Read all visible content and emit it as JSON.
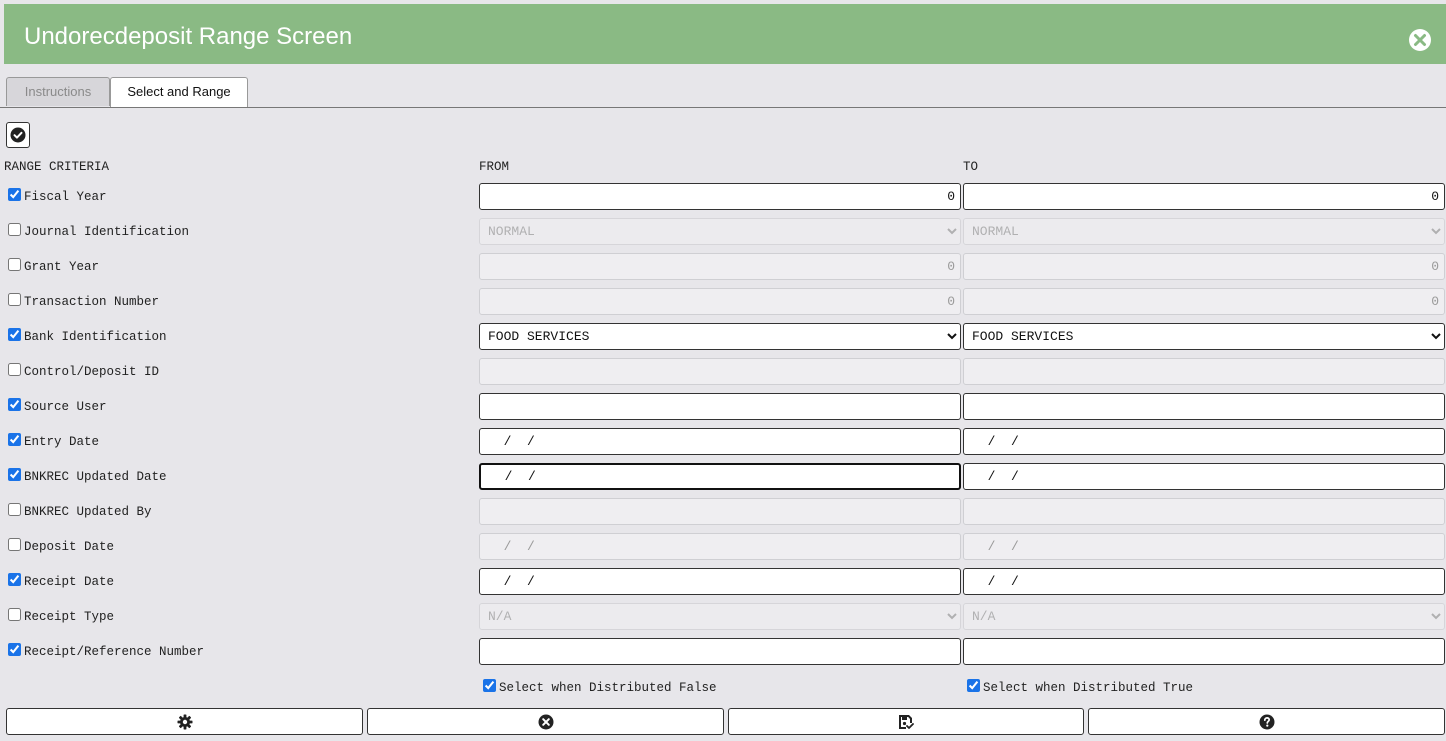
{
  "window": {
    "title": "Undorecdeposit Range Screen"
  },
  "tabs": [
    {
      "label": "Instructions",
      "active": false
    },
    {
      "label": "Select and Range",
      "active": true
    }
  ],
  "headers": {
    "criteria": "RANGE CRITERIA",
    "from": "FROM",
    "to": "TO"
  },
  "rows": [
    {
      "label": "Fiscal Year",
      "checked": true,
      "from": "0",
      "to": "0"
    },
    {
      "label": "Journal Identification",
      "checked": false,
      "from": "NORMAL",
      "to": "NORMAL"
    },
    {
      "label": "Grant Year",
      "checked": false,
      "from": "0",
      "to": "0"
    },
    {
      "label": "Transaction Number",
      "checked": false,
      "from": "0",
      "to": "0"
    },
    {
      "label": "Bank Identification",
      "checked": true,
      "from": "FOOD SERVICES",
      "to": "FOOD SERVICES"
    },
    {
      "label": "Control/Deposit ID",
      "checked": false,
      "from": "",
      "to": ""
    },
    {
      "label": "Source User",
      "checked": true,
      "from": "",
      "to": ""
    },
    {
      "label": "Entry Date",
      "checked": true,
      "from": "  /  /",
      "to": "  /  /"
    },
    {
      "label": "BNKREC Updated Date",
      "checked": true,
      "from": "  /  /",
      "to": "  /  /"
    },
    {
      "label": "BNKREC Updated By",
      "checked": false,
      "from": "",
      "to": ""
    },
    {
      "label": "Deposit Date",
      "checked": false,
      "from": "  /  /",
      "to": "  /  /"
    },
    {
      "label": "Receipt Date",
      "checked": true,
      "from": "  /  /",
      "to": "  /  /"
    },
    {
      "label": "Receipt Type",
      "checked": false,
      "from": "N/A",
      "to": "N/A"
    },
    {
      "label": "Receipt/Reference Number",
      "checked": true,
      "from": "",
      "to": ""
    }
  ],
  "distributed": {
    "false_label": "Select when Distributed False",
    "true_label": "Select when Distributed True"
  },
  "footer": {
    "buttons": [
      {
        "icon": "gear-icon"
      },
      {
        "icon": "close-circle-icon"
      },
      {
        "icon": "save-check-icon"
      },
      {
        "icon": "help-icon"
      }
    ]
  },
  "colors": {
    "titlebar": "#8aba84",
    "background": "#e7e6ea",
    "checkbox": "#1a73e8"
  }
}
